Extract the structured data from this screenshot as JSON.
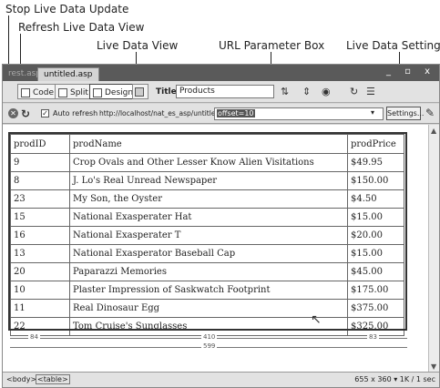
{
  "callouts": {
    "stop": "Stop Live Data Update",
    "refresh": "Refresh Live Data View",
    "live_view": "Live Data View",
    "url_box": "URL Parameter Box",
    "settings": "Live Data Settings"
  },
  "tabs": [
    {
      "label": "rest.asp",
      "active": false
    },
    {
      "label": "untitled.asp",
      "active": true
    }
  ],
  "window_controls": "_ ▫ x",
  "toolbar": {
    "code_label": "Code",
    "split_label": "Split",
    "design_label": "Design",
    "title_label": "Title:",
    "title_value": "Products"
  },
  "livebar": {
    "auto_refresh_label": "Auto refresh",
    "auto_refresh_checked": true,
    "url_prefix": "http://localhost/nat_es_asp/untitled.asp?",
    "url_param_selected": "offset=10",
    "settings_label": "Settings..."
  },
  "table": {
    "headers": [
      "prodID",
      "prodName",
      "prodPrice"
    ],
    "rows": [
      [
        "9",
        "Crop Ovals and Other Lesser Know Alien Visitations",
        "$49.95"
      ],
      [
        "8",
        "J. Lo's Real Unread Newspaper",
        "$150.00"
      ],
      [
        "23",
        "My Son, the Oyster",
        "$4.50"
      ],
      [
        "15",
        "National Exasperater Hat",
        "$15.00"
      ],
      [
        "16",
        "National Exasperater T",
        "$20.00"
      ],
      [
        "13",
        "National Exasperator Baseball Cap",
        "$15.00"
      ],
      [
        "20",
        "Paparazzi Memories",
        "$45.00"
      ],
      [
        "10",
        "Plaster Impression of Saskwatch Footprint",
        "$175.00"
      ],
      [
        "11",
        "Real Dinosaur Egg",
        "$375.00"
      ],
      [
        "22",
        "Tom Cruise's Sunglasses",
        "$325.00"
      ]
    ]
  },
  "rulers": {
    "col1": "84",
    "col2": "410",
    "col3": "83",
    "total": "599"
  },
  "status": {
    "tag_body": "<body>",
    "tag_table": "<table>",
    "info": "655 x 360 ▾ 1K / 1 sec"
  }
}
